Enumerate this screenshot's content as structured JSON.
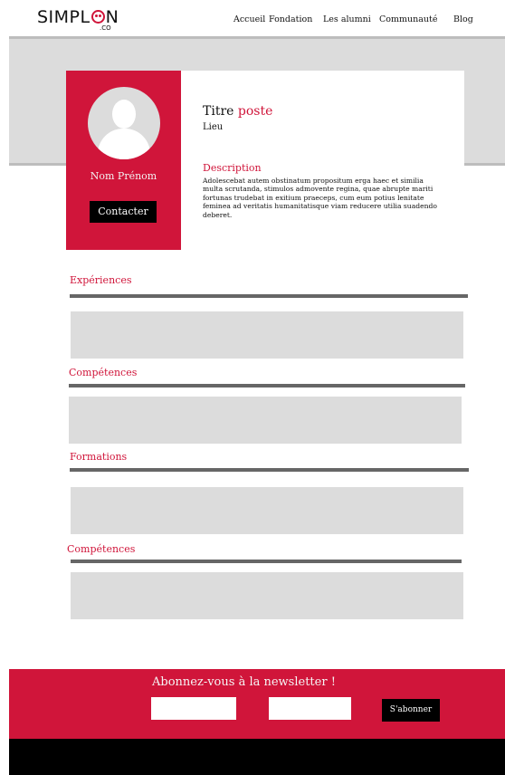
{
  "header": {
    "logo_text_1": "SIMPL",
    "logo_text_2": "N",
    "logo_sub": ".CO",
    "nav": [
      "Accueil",
      "Fondation",
      "Les alumni",
      "Communauté",
      "Blog"
    ]
  },
  "profile": {
    "avatar_icon": "user-avatar-icon",
    "name": "Nom Prénom",
    "contact_label": "Contacter",
    "title_prefix": "Titre",
    "title_accent": "poste",
    "location": "Lieu",
    "description_heading": "Description",
    "description": "Adolescebat autem obstinatum propositum erga haec et similia multa scrutanda, stimulos admovente regina, quae abrupte mariti fortunas trudebat in exitium praeceps, cum eum potius lenitate feminea ad veritatis humanitatisque viam reducere utilia suadendo deberet."
  },
  "sections": [
    {
      "title": "Expériences"
    },
    {
      "title": "Compétences"
    },
    {
      "title": "Formations"
    },
    {
      "title": "Compétences"
    }
  ],
  "newsletter": {
    "title": "Abonnez-vous à la newsletter !",
    "subscribe_label": "S'abonner"
  },
  "colors": {
    "accent": "#d0153a",
    "placeholder_grey": "#dcdcdc",
    "rule_grey": "#666666",
    "footer": "#000000"
  }
}
